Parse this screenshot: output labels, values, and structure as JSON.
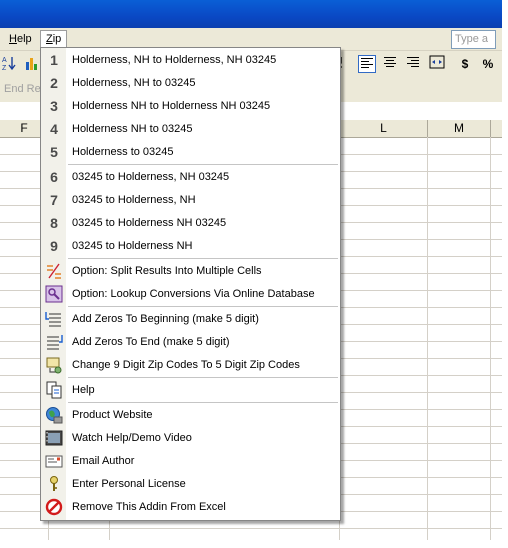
{
  "menubar": {
    "help": "Help",
    "help_u": "H",
    "help_rest": "elp",
    "zip": "Zip",
    "zip_u": "Z",
    "zip_rest": "ip",
    "type_box": "Type a"
  },
  "toolbar2": {
    "end_label": "End Re"
  },
  "columns": [
    "F",
    "L",
    "M"
  ],
  "menu": {
    "items": [
      {
        "icon": "1",
        "label": "Holderness, NH to Holderness, NH 03245"
      },
      {
        "icon": "2",
        "label": "Holderness, NH to 03245"
      },
      {
        "icon": "3",
        "label": "Holderness NH to Holderness NH 03245"
      },
      {
        "icon": "4",
        "label": "Holderness NH to 03245"
      },
      {
        "icon": "5",
        "label": "Holderness to 03245"
      },
      {
        "icon": "6",
        "label": "03245 to Holderness, NH 03245"
      },
      {
        "icon": "7",
        "label": "03245 to Holderness, NH"
      },
      {
        "icon": "8",
        "label": "03245 to Holderness NH 03245"
      },
      {
        "icon": "9",
        "label": "03245 to Holderness NH"
      },
      {
        "icon": "split-icon",
        "label": "Option: Split Results Into Multiple Cells"
      },
      {
        "icon": "lookup-icon",
        "label": "Option: Lookup Conversions Via Online Database"
      },
      {
        "icon": "zeros-begin-icon",
        "label": "Add Zeros To Beginning (make 5 digit)"
      },
      {
        "icon": "zeros-end-icon",
        "label": "Add Zeros To End (make 5 digit)"
      },
      {
        "icon": "change-zip-icon",
        "label": "Change 9 Digit Zip Codes To 5 Digit Zip Codes"
      },
      {
        "icon": "help-icon",
        "label": "Help"
      },
      {
        "icon": "globe-icon",
        "label": "Product Website"
      },
      {
        "icon": "video-icon",
        "label": "Watch Help/Demo Video"
      },
      {
        "icon": "email-icon",
        "label": "Email Author"
      },
      {
        "icon": "key-icon",
        "label": "Enter Personal License"
      },
      {
        "icon": "remove-icon",
        "label": "Remove This Addin From Excel"
      }
    ]
  }
}
